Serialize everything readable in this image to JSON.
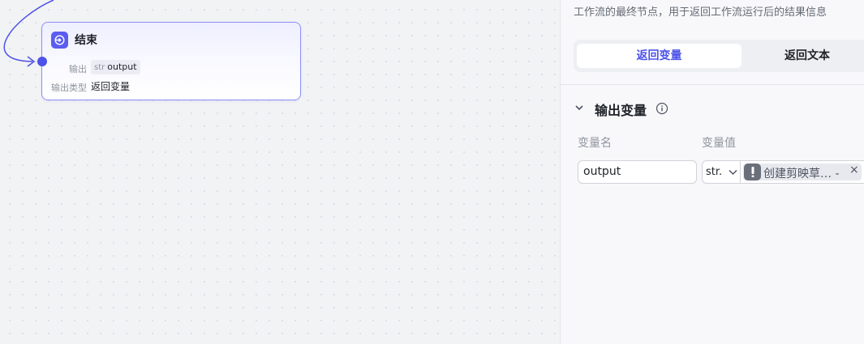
{
  "canvas": {
    "node": {
      "title": "结束",
      "output_label": "输出",
      "output_type": "str",
      "output_name": "output",
      "output_kind_label": "输出类型",
      "output_kind_value": "返回变量"
    }
  },
  "panel": {
    "description": "工作流的最终节点，用于返回工作流运行后的结果信息",
    "tabs": [
      {
        "label": "返回变量",
        "active": true
      },
      {
        "label": "返回文本",
        "active": false
      }
    ],
    "section": {
      "title": "输出变量",
      "col_name": "变量名",
      "col_value": "变量值",
      "row": {
        "name": "output",
        "type": "str.",
        "value": "创建剪映草… -",
        "remove": "×"
      }
    }
  },
  "colors": {
    "accent": "#4d53e8",
    "node_border": "#8b8ff7",
    "warning_icon_bg": "#6b6f7a"
  },
  "icons": [
    "end-node-icon",
    "chevron-down-icon",
    "info-icon",
    "warning-icon",
    "close-icon"
  ]
}
